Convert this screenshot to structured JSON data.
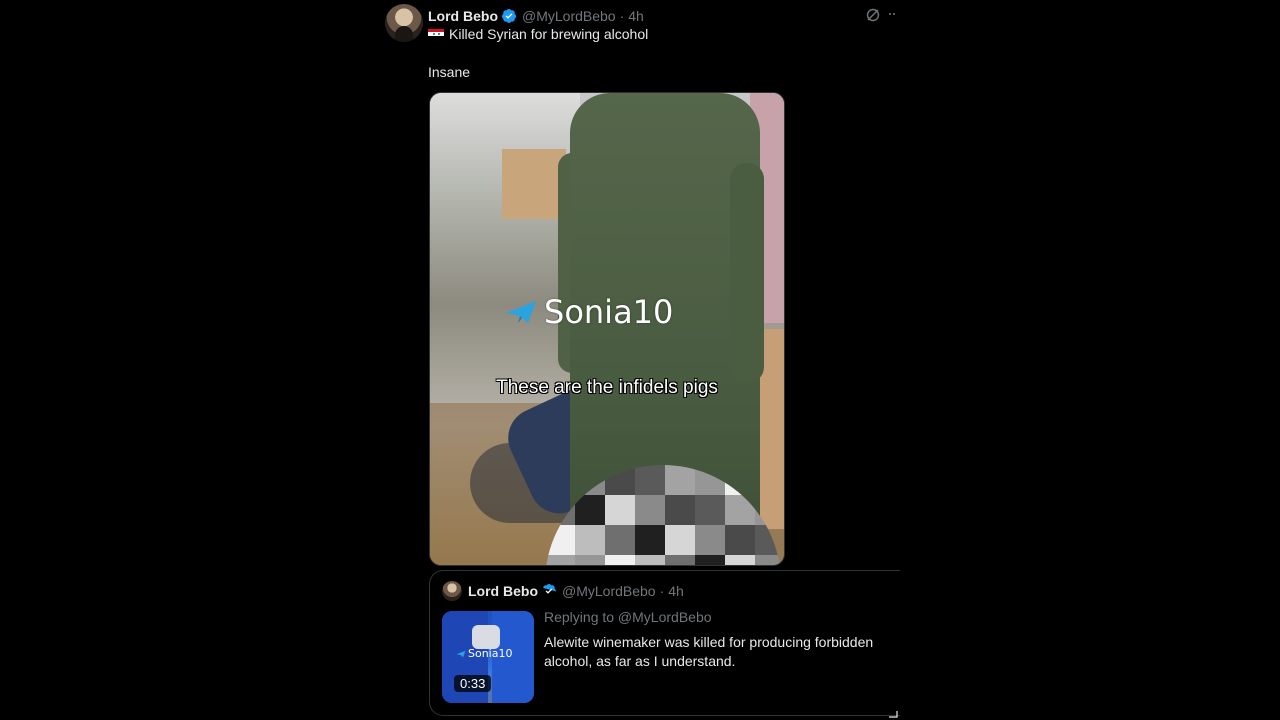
{
  "tweet": {
    "author_name": "Lord Bebo",
    "handle": "@MyLordBebo",
    "separator": "·",
    "time": "4h",
    "line1": "Killed Syrian for brewing alcohol",
    "line2": "Insane",
    "flag_icon": "syria-flag-icon",
    "media": {
      "watermark": "Sonia10",
      "caption": "These are the infidels pigs"
    }
  },
  "quote": {
    "author_name": "Lord Bebo",
    "handle": "@MyLordBebo",
    "separator": "·",
    "time": "4h",
    "replying_to": "Replying to @MyLordBebo",
    "text": "Alewite winemaker was killed for producing forbidden alcohol, as far as I understand.",
    "thumbnail": {
      "watermark": "Sonia10",
      "duration": "0:33"
    }
  },
  "colors": {
    "background": "#000000",
    "text": "#e7e9ea",
    "muted": "#71767b",
    "verified": "#1d9bf0",
    "border": "#2f3336"
  }
}
